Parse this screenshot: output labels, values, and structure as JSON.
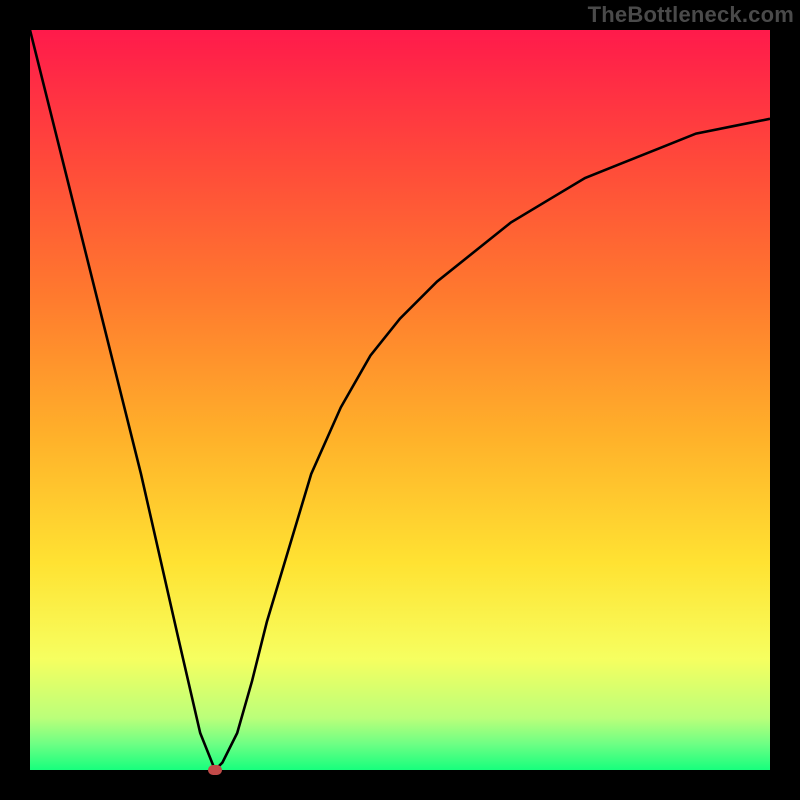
{
  "watermark": "TheBottleneck.com",
  "colors": {
    "frame_bg": "#000000",
    "curve_stroke": "#000000",
    "marker_fill": "#c24a49",
    "gradient_stops": [
      {
        "offset": 0.0,
        "color": "#ff1a4b"
      },
      {
        "offset": 0.18,
        "color": "#ff4a3a"
      },
      {
        "offset": 0.36,
        "color": "#ff7a2e"
      },
      {
        "offset": 0.55,
        "color": "#ffb12a"
      },
      {
        "offset": 0.72,
        "color": "#ffe232"
      },
      {
        "offset": 0.85,
        "color": "#f6ff60"
      },
      {
        "offset": 0.93,
        "color": "#baff7a"
      },
      {
        "offset": 0.965,
        "color": "#6dff84"
      },
      {
        "offset": 1.0,
        "color": "#17ff7d"
      }
    ]
  },
  "chart_data": {
    "type": "line",
    "title": "",
    "xlabel": "",
    "ylabel": "",
    "xlim": [
      0,
      100
    ],
    "ylim": [
      0,
      100
    ],
    "grid": false,
    "legend": false,
    "series": [
      {
        "name": "curve",
        "x": [
          0,
          5,
          10,
          15,
          20,
          23,
          25,
          26,
          28,
          30,
          32,
          35,
          38,
          42,
          46,
          50,
          55,
          60,
          65,
          70,
          75,
          80,
          85,
          90,
          95,
          100
        ],
        "y": [
          100,
          80,
          60,
          40,
          18,
          5,
          0,
          1,
          5,
          12,
          20,
          30,
          40,
          49,
          56,
          61,
          66,
          70,
          74,
          77,
          80,
          82,
          84,
          86,
          87,
          88
        ]
      }
    ],
    "annotations": [
      {
        "name": "min-marker",
        "x": 25,
        "y": 0
      }
    ]
  }
}
